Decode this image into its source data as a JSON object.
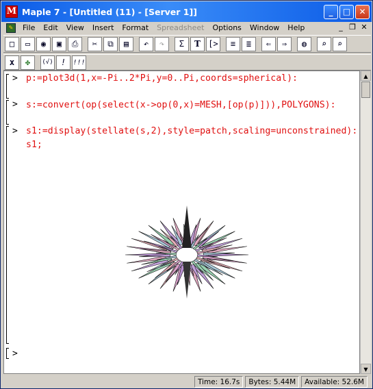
{
  "window": {
    "title": "Maple 7  - [Untitled (11) - [Server 1]]",
    "controls": {
      "minimize": "_",
      "maximize": "□",
      "close": "✕"
    }
  },
  "menubar": {
    "items": [
      {
        "label": "File"
      },
      {
        "label": "Edit"
      },
      {
        "label": "View"
      },
      {
        "label": "Insert"
      },
      {
        "label": "Format"
      },
      {
        "label": "Spreadsheet",
        "disabled": true
      },
      {
        "label": "Options"
      },
      {
        "label": "Window"
      },
      {
        "label": "Help"
      }
    ],
    "doc_controls": {
      "minimize": "_",
      "restore": "❐",
      "close": "✕"
    }
  },
  "toolbar": {
    "row1": [
      "new-icon",
      "open-icon",
      "open-url-icon",
      "save-icon",
      "print-icon",
      "cut-icon",
      "copy-icon",
      "paste-icon",
      "undo-icon",
      "redo-icon",
      "sigma-icon",
      "text-icon",
      "prompt-icon",
      "indent-icon",
      "outdent-icon",
      "back-icon",
      "forward-icon",
      "stop-icon",
      "zoom-in-icon",
      "zoom-out-icon"
    ],
    "row2": [
      "math-mode-icon",
      "maple-leaf-icon",
      "execute-icon",
      "exclamation-icon",
      "execute-all-icon"
    ],
    "glyphs": {
      "sigma": "Σ",
      "text": "T",
      "prompt": "[>",
      "execute": "(√)",
      "exclamation": "!",
      "execute_all": "!!!",
      "math": "x"
    }
  },
  "worksheet": {
    "prompt_symbol": ">",
    "commands": [
      {
        "text": "p:=plot3d(1,x=-Pi..2*Pi,y=0..Pi,coords=spherical):"
      },
      {
        "text": "s:=convert(op(select(x->op(0,x)=MESH,[op(p)])),POLYGONS):"
      },
      {
        "text": "s1:=display(stellate(s,2),style=patch,scaling=unconstrained):s1;"
      }
    ],
    "empty_prompt": ">"
  },
  "status": {
    "time": "Time: 16.7s",
    "bytes": "Bytes: 5.44M",
    "available": "Available: 52.6M"
  },
  "colors": {
    "titlebar": "#0a5ae6",
    "code": "#e01010"
  }
}
